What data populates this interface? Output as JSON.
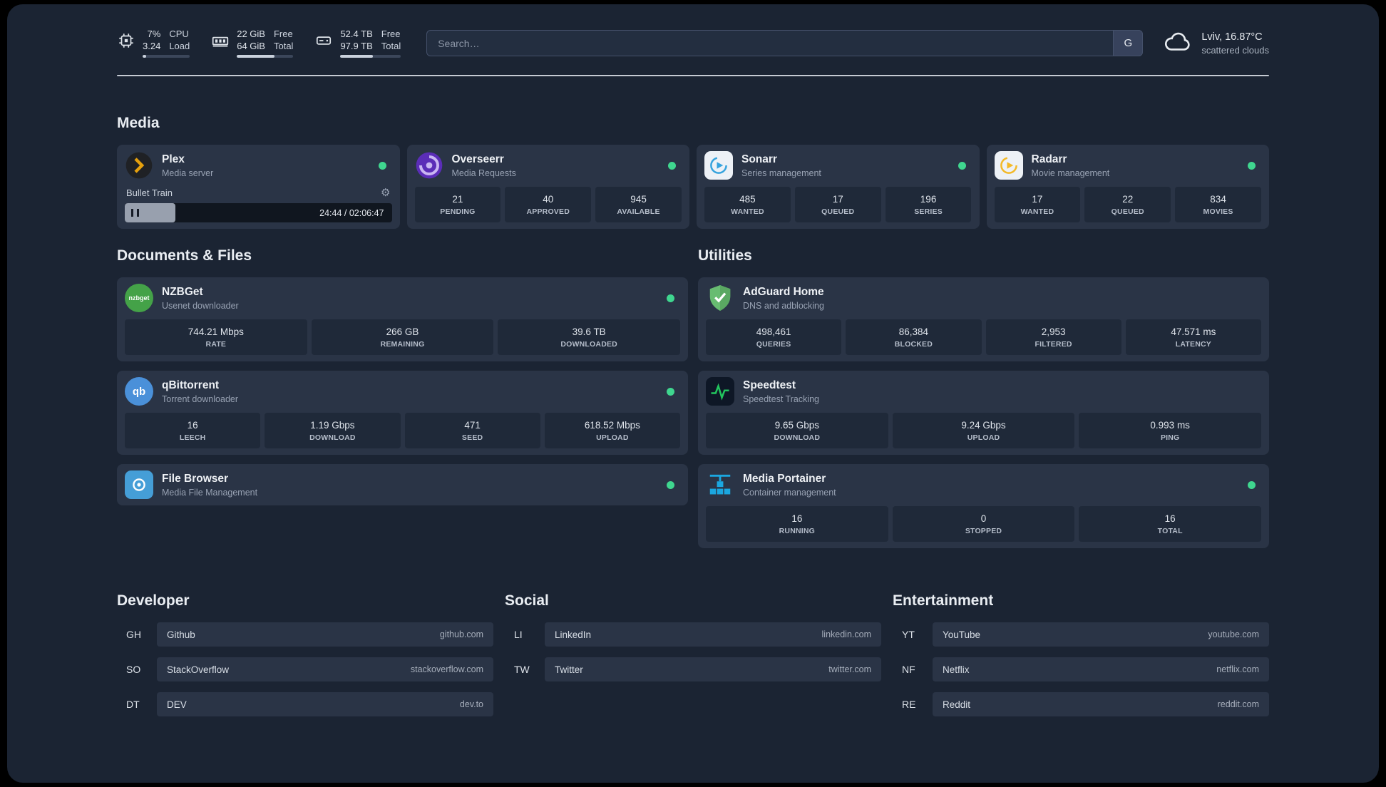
{
  "colors": {
    "status_green": "#3fd68f"
  },
  "topbar": {
    "resources": [
      {
        "icon": "cpu-icon",
        "values": [
          "7%",
          "3.24"
        ],
        "labels": [
          "CPU",
          "Load"
        ],
        "bar_pct": 7
      },
      {
        "icon": "memory-icon",
        "values": [
          "22 GiB",
          "64 GiB"
        ],
        "labels": [
          "Free",
          "Total"
        ],
        "bar_pct": 66
      },
      {
        "icon": "disk-icon",
        "values": [
          "52.4 TB",
          "97.9 TB"
        ],
        "labels": [
          "Free",
          "Total"
        ],
        "bar_pct": 54
      }
    ],
    "search": {
      "placeholder": "Search…",
      "button_label": "G"
    },
    "weather": {
      "location": "Lviv, 16.87°C",
      "condition": "scattered clouds"
    }
  },
  "sections": {
    "media": {
      "title": "Media",
      "cards": [
        {
          "name": "Plex",
          "desc": "Media server",
          "player": {
            "title": "Bullet Train",
            "time": "24:44 / 02:06:47",
            "progress_pct": 19
          }
        },
        {
          "name": "Overseerr",
          "desc": "Media Requests",
          "stats": [
            {
              "value": "21",
              "label": "PENDING"
            },
            {
              "value": "40",
              "label": "APPROVED"
            },
            {
              "value": "945",
              "label": "AVAILABLE"
            }
          ]
        },
        {
          "name": "Sonarr",
          "desc": "Series management",
          "stats": [
            {
              "value": "485",
              "label": "WANTED"
            },
            {
              "value": "17",
              "label": "QUEUED"
            },
            {
              "value": "196",
              "label": "SERIES"
            }
          ]
        },
        {
          "name": "Radarr",
          "desc": "Movie management",
          "stats": [
            {
              "value": "17",
              "label": "WANTED"
            },
            {
              "value": "22",
              "label": "QUEUED"
            },
            {
              "value": "834",
              "label": "MOVIES"
            }
          ]
        }
      ]
    },
    "documents": {
      "title": "Documents & Files",
      "cards": [
        {
          "name": "NZBGet",
          "desc": "Usenet downloader",
          "icon_text": "nzbget",
          "stats": [
            {
              "value": "744.21 Mbps",
              "label": "RATE"
            },
            {
              "value": "266 GB",
              "label": "REMAINING"
            },
            {
              "value": "39.6 TB",
              "label": "DOWNLOADED"
            }
          ]
        },
        {
          "name": "qBittorrent",
          "desc": "Torrent downloader",
          "icon_text": "qb",
          "stats": [
            {
              "value": "16",
              "label": "LEECH"
            },
            {
              "value": "1.19 Gbps",
              "label": "DOWNLOAD"
            },
            {
              "value": "471",
              "label": "SEED"
            },
            {
              "value": "618.52 Mbps",
              "label": "UPLOAD"
            }
          ]
        },
        {
          "name": "File Browser",
          "desc": "Media File Management"
        }
      ]
    },
    "utilities": {
      "title": "Utilities",
      "cards": [
        {
          "name": "AdGuard Home",
          "desc": "DNS and adblocking",
          "stats": [
            {
              "value": "498,461",
              "label": "QUERIES"
            },
            {
              "value": "86,384",
              "label": "BLOCKED"
            },
            {
              "value": "2,953",
              "label": "FILTERED"
            },
            {
              "value": "47.571 ms",
              "label": "LATENCY"
            }
          ]
        },
        {
          "name": "Speedtest",
          "desc": "Speedtest Tracking",
          "stats": [
            {
              "value": "9.65 Gbps",
              "label": "DOWNLOAD"
            },
            {
              "value": "9.24 Gbps",
              "label": "UPLOAD"
            },
            {
              "value": "0.993 ms",
              "label": "PING"
            }
          ]
        },
        {
          "name": "Media Portainer",
          "desc": "Container management",
          "stats": [
            {
              "value": "16",
              "label": "RUNNING"
            },
            {
              "value": "0",
              "label": "STOPPED"
            },
            {
              "value": "16",
              "label": "TOTAL"
            }
          ]
        }
      ]
    },
    "bookmarks": [
      {
        "title": "Developer",
        "items": [
          {
            "abbr": "GH",
            "name": "Github",
            "url": "github.com"
          },
          {
            "abbr": "SO",
            "name": "StackOverflow",
            "url": "stackoverflow.com"
          },
          {
            "abbr": "DT",
            "name": "DEV",
            "url": "dev.to"
          }
        ]
      },
      {
        "title": "Social",
        "items": [
          {
            "abbr": "LI",
            "name": "LinkedIn",
            "url": "linkedin.com"
          },
          {
            "abbr": "TW",
            "name": "Twitter",
            "url": "twitter.com"
          }
        ]
      },
      {
        "title": "Entertainment",
        "items": [
          {
            "abbr": "YT",
            "name": "YouTube",
            "url": "youtube.com"
          },
          {
            "abbr": "NF",
            "name": "Netflix",
            "url": "netflix.com"
          },
          {
            "abbr": "RE",
            "name": "Reddit",
            "url": "reddit.com"
          }
        ]
      }
    ]
  }
}
